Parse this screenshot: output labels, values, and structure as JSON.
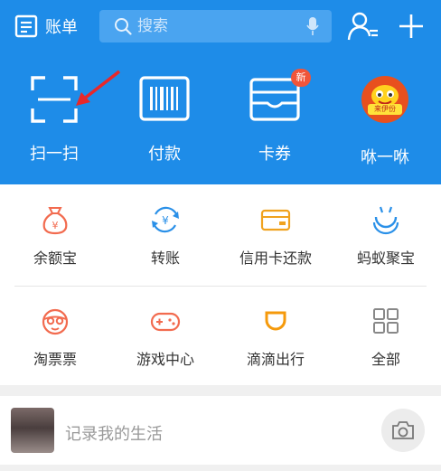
{
  "header": {
    "bill_label": "账单",
    "search_placeholder": "搜索",
    "accent": "#1e8ce8"
  },
  "quick_actions": [
    {
      "label": "扫一扫",
      "icon": "scan-icon"
    },
    {
      "label": "付款",
      "icon": "barcode-icon"
    },
    {
      "label": "卡券",
      "icon": "card-wallet-icon",
      "badge": "新"
    },
    {
      "label": "咻一咻",
      "icon": "mascot-icon",
      "mascot_text": "来伊份"
    }
  ],
  "grid": [
    {
      "label": "余额宝",
      "icon": "money-bag-icon"
    },
    {
      "label": "转账",
      "icon": "transfer-icon"
    },
    {
      "label": "信用卡还款",
      "icon": "credit-card-icon"
    },
    {
      "label": "蚂蚁聚宝",
      "icon": "ant-treasure-icon"
    },
    {
      "label": "淘票票",
      "icon": "movie-ticket-icon"
    },
    {
      "label": "游戏中心",
      "icon": "gamepad-icon"
    },
    {
      "label": "滴滴出行",
      "icon": "didi-icon"
    },
    {
      "label": "全部",
      "icon": "all-apps-icon"
    }
  ],
  "post": {
    "placeholder": "记录我的生活"
  }
}
